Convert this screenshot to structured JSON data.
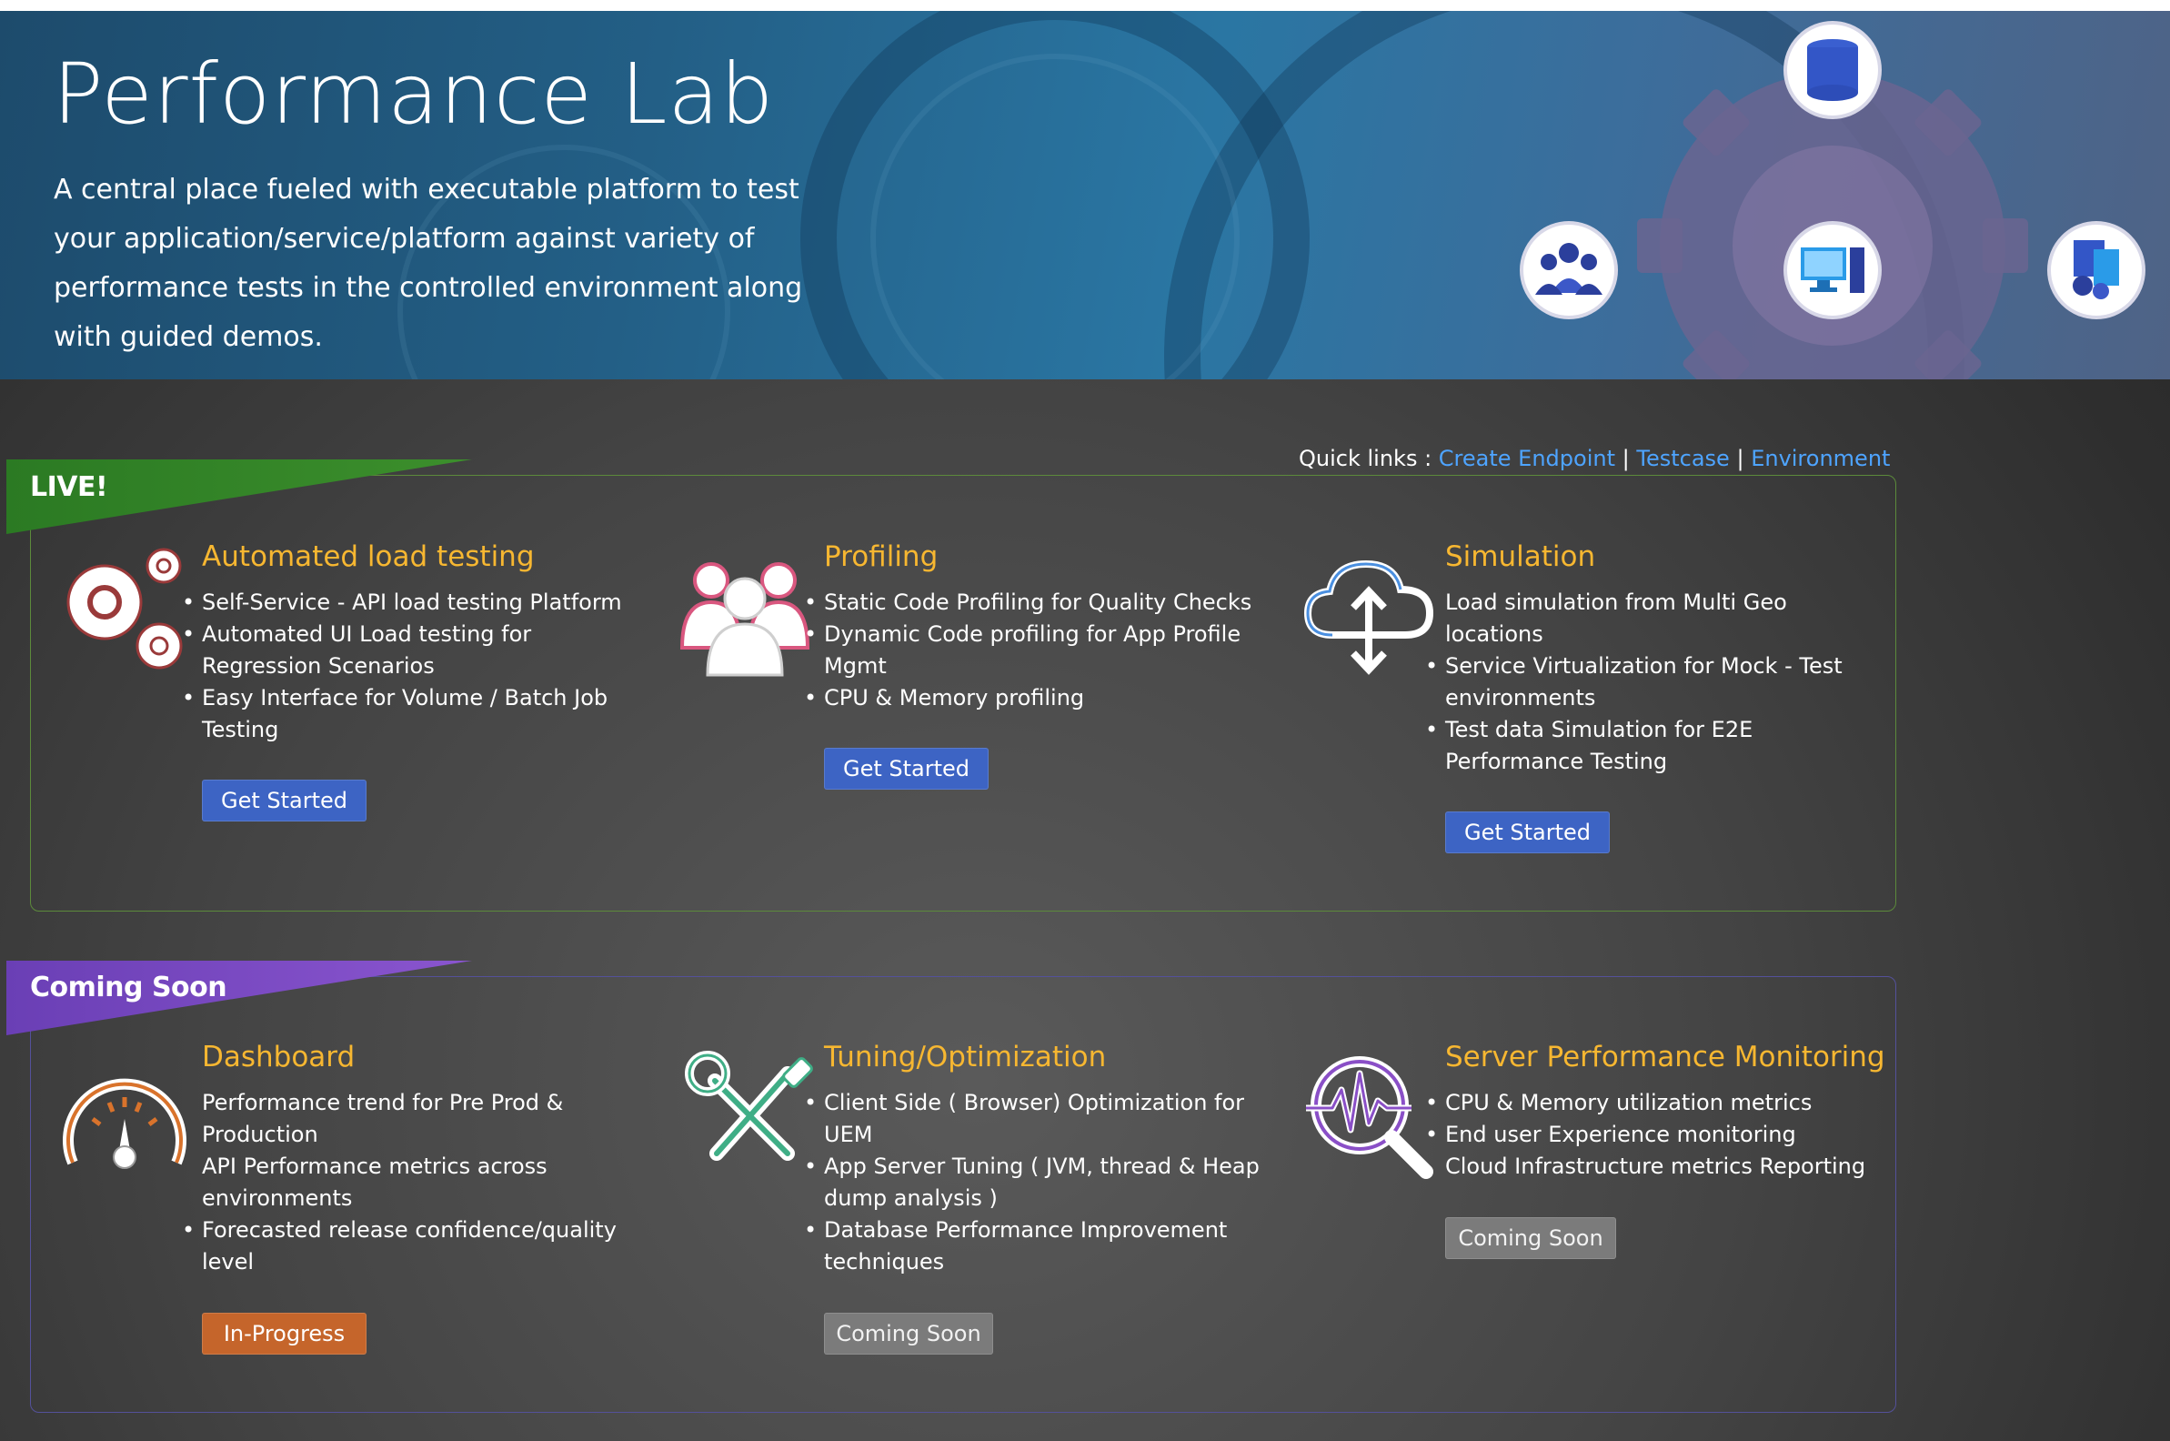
{
  "hero": {
    "title": "Performance Lab",
    "description": "A central place fueled with executable platform to test your application/service/platform against variety of performance tests in the controlled environment along with guided demos."
  },
  "quick_links": {
    "label": "Quick links :",
    "separator": "|",
    "links": [
      "Create Endpoint",
      "Testcase",
      "Environment"
    ]
  },
  "sections": {
    "live": {
      "label": "LIVE!",
      "cards": [
        {
          "title": "Automated load testing",
          "items": [
            "Self-Service - API load testing Platform",
            "Automated UI Load testing for",
            "Regression Scenarios",
            "Easy Interface for Volume / Batch Job",
            "Testing"
          ],
          "button": "Get Started"
        },
        {
          "title": "Profiling",
          "items": [
            "Static Code Profiling for Quality Checks",
            "Dynamic Code profiling for App Profile",
            "Mgmt",
            "CPU & Memory profiling"
          ],
          "button": "Get Started"
        },
        {
          "title": "Simulation",
          "items": [
            "Load simulation from Multi Geo",
            "locations",
            "Service Virtualization for Mock - Test",
            "environments",
            "Test data Simulation for E2E",
            "Performance Testing"
          ],
          "button": "Get Started"
        }
      ]
    },
    "coming_soon": {
      "label": "Coming Soon",
      "cards": [
        {
          "title": "Dashboard",
          "items": [
            "Performance trend for Pre Prod &",
            "Production",
            "API Performance metrics across",
            "environments",
            "Forecasted release confidence/quality",
            "level"
          ],
          "button": "In-Progress"
        },
        {
          "title": "Tuning/Optimization",
          "items": [
            "Client Side ( Browser) Optimization for",
            "UEM",
            "App Server Tuning ( JVM, thread & Heap",
            "dump analysis )",
            "Database Performance Improvement",
            "techniques"
          ],
          "button": "Coming Soon"
        },
        {
          "title": "Server Performance Monitoring",
          "items": [
            "CPU & Memory utilization metrics",
            "End user Experience monitoring",
            "Cloud Infrastructure metrics Reporting"
          ],
          "button": "Coming Soon"
        }
      ]
    }
  },
  "icons": {
    "hero": [
      "database-icon",
      "users-icon",
      "desktop-computer-icon",
      "server-stack-icon"
    ],
    "cards": [
      "gears-icon",
      "users-icon",
      "cloud-upload-download-icon",
      "speedometer-icon",
      "wrench-screwdriver-icon",
      "monitor-search-icon"
    ]
  },
  "colors": {
    "title_accent": "#f7b731",
    "link": "#4ea4ff",
    "button_primary": "#3d64c4",
    "button_in_progress": "#c5652b",
    "button_disabled": "#7b7b7b",
    "ribbon_live": "#2b7a23",
    "ribbon_coming_soon": "#6a3fb5"
  }
}
